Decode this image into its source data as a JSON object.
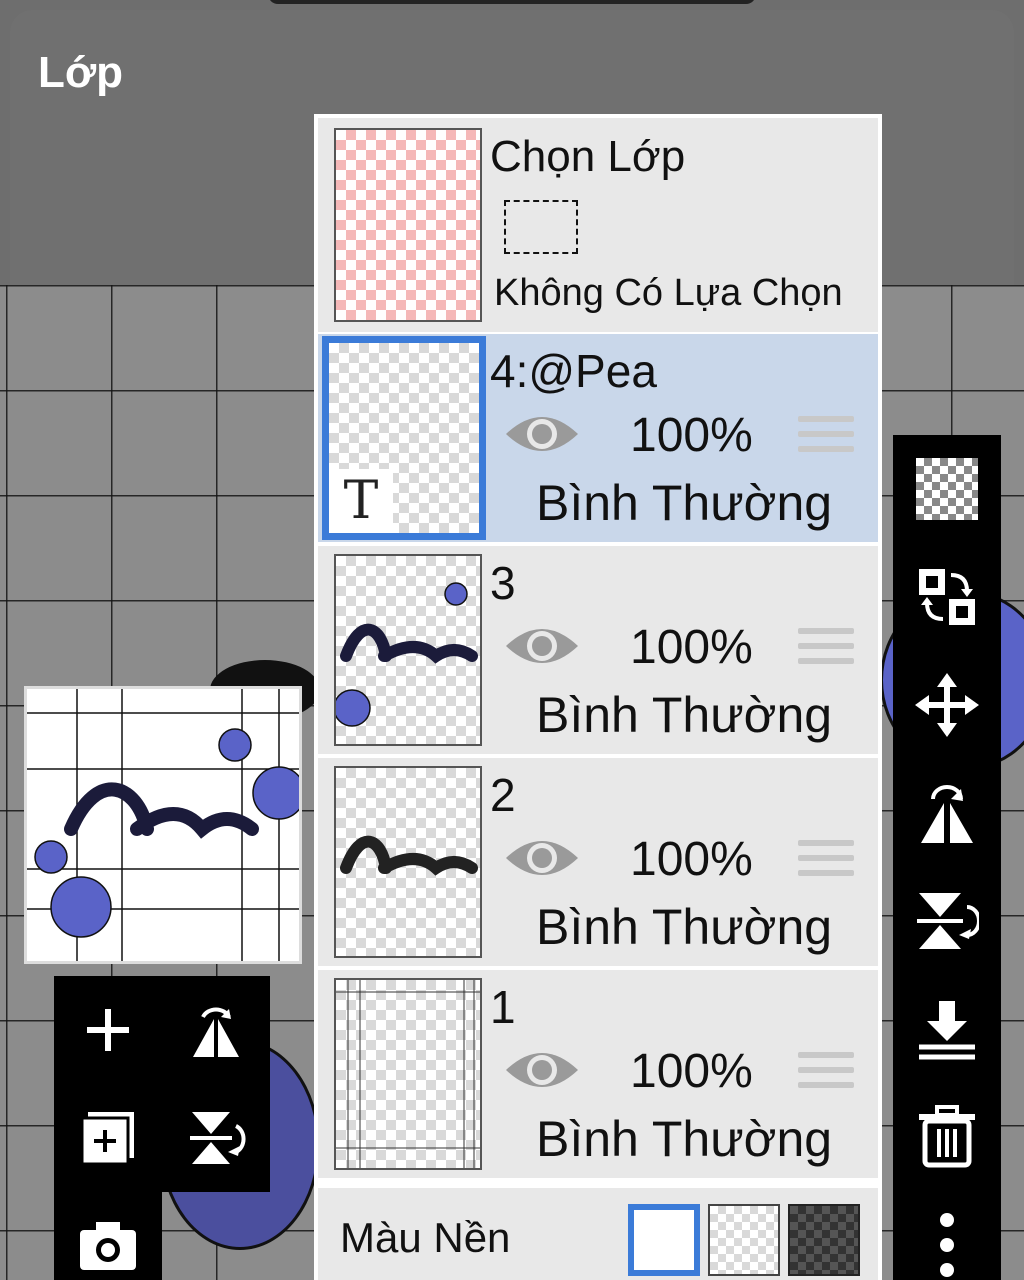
{
  "header": {
    "title": "Lớp"
  },
  "selection_layer": {
    "title": "Chọn Lớp",
    "subtitle": "Không Có Lựa Chọn"
  },
  "layers": [
    {
      "name": "4:@Pea",
      "opacity": "100%",
      "blend": "Bình Thường",
      "active": true,
      "thumb_letter": "T"
    },
    {
      "name": "3",
      "opacity": "100%",
      "blend": "Bình Thường",
      "active": false
    },
    {
      "name": "2",
      "opacity": "100%",
      "blend": "Bình Thường",
      "active": false
    },
    {
      "name": "1",
      "opacity": "100%",
      "blend": "Bình Thường",
      "active": false
    }
  ],
  "background": {
    "label": "Màu Nền",
    "options": [
      "white",
      "transparent",
      "dark-checker"
    ],
    "selected": "white"
  },
  "right_toolbar": [
    "transparency-lock-icon",
    "swap-layer-icon",
    "move-icon",
    "flip-horizontal-icon",
    "flip-vertical-icon",
    "merge-down-icon",
    "delete-icon",
    "more-icon"
  ],
  "left_toolbar": [
    "add-layer-icon",
    "flip-horizontal-icon",
    "duplicate-layer-icon",
    "flip-vertical-icon",
    "camera-icon"
  ],
  "colors": {
    "accent": "#3b7bd8",
    "active_row": "#c9d7ea",
    "row": "#e8e8e8",
    "art_blue": "#5a63c8"
  }
}
